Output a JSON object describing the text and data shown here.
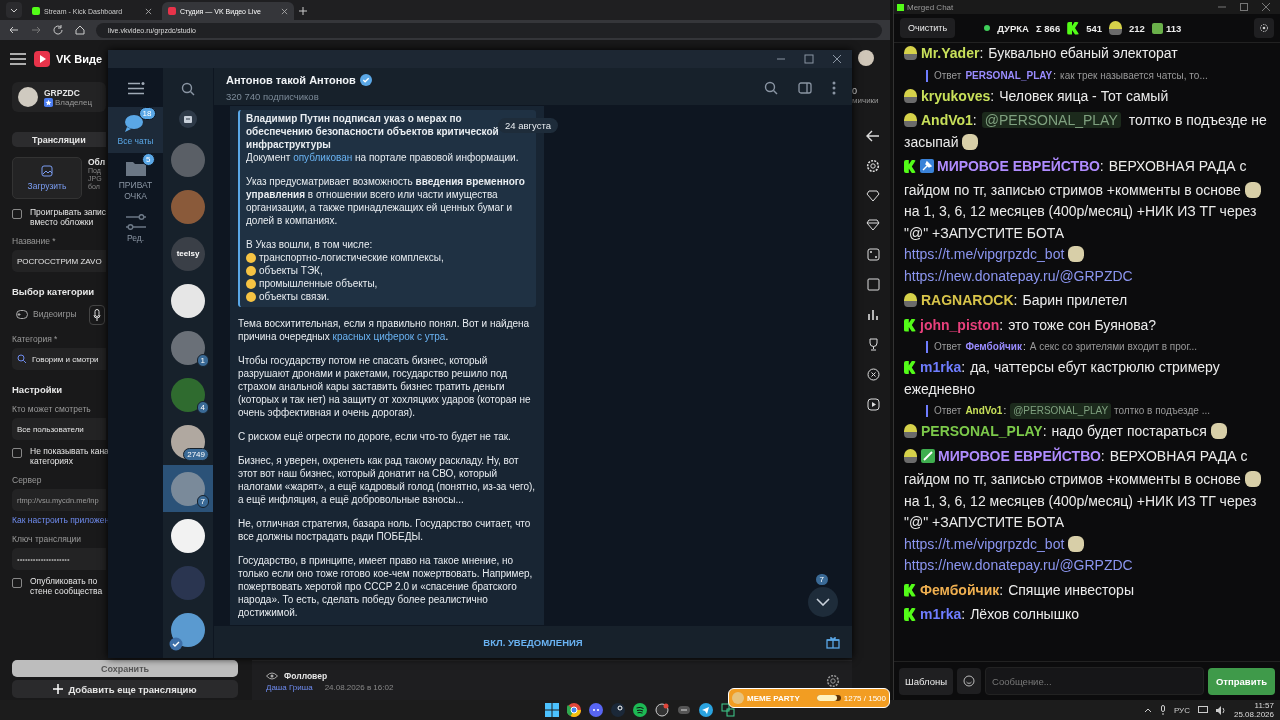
{
  "browser": {
    "tabs": [
      {
        "label": "Stream - Kick Dashboard",
        "selected": false
      },
      {
        "label": "Студия — VK Видео Live",
        "selected": true
      }
    ],
    "url": "live.vkvideo.ru/grpzdc/studio",
    "site_title": "VK Виде",
    "corner_count": "0",
    "corner_label": "мичики",
    "user": {
      "name": "GRPZDC",
      "role": "Владелец"
    },
    "section_tab": "Трансляции",
    "upload": {
      "button": "Загрузить",
      "title": "Обл",
      "hints": [
        "Под",
        "JPG",
        "бол"
      ]
    },
    "loop_check": {
      "lines": [
        "Проигрывать запис",
        "вместо обложки"
      ],
      "checked": false
    },
    "name_label": "Название *",
    "name_value": "РОСГОССТРИМ ZAVO",
    "category_heading": "Выбор категории",
    "category_chip": "Видеоигры",
    "category_label": "Категория *",
    "category_value": "Говорим и смотри",
    "settings_heading": "Настройки",
    "audience_label": "Кто может смотреть",
    "audience_value": "Все пользователи",
    "hide_check": {
      "lines": [
        "Не показывать кана",
        "категориях"
      ],
      "checked": false
    },
    "server_label": "Сервер",
    "server_value": "rtmp://vsu.mycdn.me/inp",
    "help_link": "Как настроить приложен",
    "key_label": "Ключ трансляции",
    "key_value": "••••••••••••••••••••",
    "publish_check": {
      "lines": [
        "Опубликовать по",
        "стене сообщества"
      ],
      "checked": false
    },
    "save_button": "Сохранить",
    "add_button": "Добавить еще трансляцию",
    "follower": {
      "label": "Фолловер",
      "name": "Даша Гриша",
      "date": "24.08.2026 в 16:02"
    }
  },
  "telegram": {
    "channel": "Антонов такой Антонов",
    "verified": true,
    "subscribers": "320 740 подписчиков",
    "folders": [
      {
        "label": "Все чаты",
        "badge": "18",
        "selected": true
      },
      {
        "label": "ПРИВАТ ОЧКА",
        "badge": "5",
        "selected": false
      },
      {
        "label": "Ред.",
        "selected": false
      }
    ],
    "chats": [
      {
        "selected": false
      },
      {
        "selected": false
      },
      {
        "selected": false,
        "label": "teelsy"
      },
      {
        "selected": false
      },
      {
        "selected": false,
        "badge": "1"
      },
      {
        "selected": false,
        "badge": "4"
      },
      {
        "selected": false,
        "badge": "2749"
      },
      {
        "selected": true,
        "badge": "7"
      },
      {
        "selected": false
      },
      {
        "selected": false
      },
      {
        "selected": false,
        "verified": true
      }
    ],
    "date_pill": "24 августа",
    "quote": {
      "title": "Владимир Путин подписал указ о мерах по обеспечению безопасности объектов критической инфраструктуры",
      "paragraphs": [
        [
          {
            "kind": "text",
            "text": "Документ "
          },
          {
            "kind": "link",
            "text": "опубликован"
          },
          {
            "kind": "text",
            "text": " на портале правовой информации."
          }
        ],
        [
          {
            "kind": "text",
            "text": "Указ предусматривает возможность **введения временного управления** в отношении всего или части имущества организации, а также принадлежащих ей ценных бумаг и долей в компаниях."
          }
        ]
      ],
      "list_intro": "В Указ вошли, в том числе:",
      "list": [
        "транспортно-логистические комплексы,",
        "объекты ТЭК,",
        "промышленные объекты,",
        "объекты связи."
      ]
    },
    "paragraphs": [
      [
        {
          "kind": "text",
          "text": "Тема восхитительная, если я правильно понял. Вот и найдена причина очередных "
        },
        {
          "kind": "link",
          "text": "красных циферок с утра"
        },
        {
          "kind": "text",
          "text": "."
        }
      ],
      [
        {
          "kind": "text",
          "text": "Чтобы государству потом не спасать бизнес, который разрушают дронами и ракетами, государство решило под страхом анальной кары заставить бизнес тратить деньги (которых и так нет) на защиту от хохляцких ударов (которая не очень эффективная и очень дорогая)."
        }
      ],
      [
        {
          "kind": "text",
          "text": "С риском ещё огрести по дороге, если что-то будет не так."
        }
      ],
      [
        {
          "kind": "text",
          "text": "Бизнес, я уверен, охренеть как рад такому раскладу. Ну, вот этот вот наш бизнес, который донатит на СВО, который налогами «жарят», а ещё кадровый голод (понятно, из-за чего), а ещё инфляция, а ещё добровольные взносы..."
        }
      ],
      [
        {
          "kind": "text",
          "text": "Не, отличная стратегия, базара ноль. Государство считает, что все должны пострадать ради ПОБЕДЫ."
        }
      ],
      [
        {
          "kind": "text",
          "text": "Государство, в принципе, имеет право на такое мнение, но только если оно тоже готово кое-чем пожертвовать. Например, пожертвовать херотой про СССР 2.0 и «спасение братского народа». То есть, сделать победу более реалистично достижимой."
        }
      ]
    ],
    "unread": "7",
    "footer": "ВКЛ. УВЕДОМЛЕНИЯ"
  },
  "chat": {
    "title": "Merged Chat",
    "clear_button": "Очистить",
    "channel": "ДУРКА",
    "total": "Σ 866",
    "counts": [
      {
        "kind": "kick",
        "value": "541"
      },
      {
        "kind": "figure",
        "value": "212"
      },
      {
        "kind": "green",
        "value": "113"
      }
    ],
    "messages": [
      {
        "kind": "message",
        "badges": [
          {
            "kind": "figure"
          }
        ],
        "user": "Mr.Yader",
        "separator": ":",
        "color": "#c8e05a",
        "segments": [
          {
            "kind": "text",
            "text": "Буквально ебаный электорат"
          }
        ]
      },
      {
        "kind": "reply",
        "prefix": "Ответ",
        "user": "PERSONAL_PLAY",
        "separator": ":",
        "color": "#9a8cff",
        "segments": [
          {
            "kind": "text",
            "text": "как трек называется чатсы, то..."
          }
        ]
      },
      {
        "kind": "message",
        "badges": [
          {
            "kind": "figure"
          }
        ],
        "user": "kryukoves",
        "separator": ":",
        "color": "#c8e05a",
        "segments": [
          {
            "kind": "text",
            "text": "Человек яица - Тот самый"
          }
        ]
      },
      {
        "kind": "message",
        "badges": [
          {
            "kind": "figure"
          }
        ],
        "user": "AndVo1",
        "separator": ":",
        "color": "#c8e05a",
        "segments": [
          {
            "kind": "mention",
            "text": "@PERSONAL_PLAY"
          },
          {
            "kind": "text",
            "text": " толтко в подъезде не засыпай"
          },
          {
            "kind": "emote"
          }
        ]
      },
      {
        "kind": "message",
        "badges": [
          {
            "kind": "kick"
          },
          {
            "kind": "tool"
          }
        ],
        "user": "МИРОВОЕ ЕВРЕЙСТВО",
        "separator": ":",
        "color": "#b08cff",
        "segments": [
          {
            "kind": "text",
            "text": "ВЕРХОВНАЯ РАДА с гайдом по тг, записью стримов +комменты в основе"
          },
          {
            "kind": "emote"
          },
          {
            "kind": "text",
            "text": "на 1, 3, 6, 12 месяцев (400р/месяц) +НИК ИЗ ТГ через \"@\" +ЗАПУСТИТЕ БОТА"
          },
          {
            "kind": "break"
          },
          {
            "kind": "link",
            "text": "https://t.me/vipgrpzdc_bot"
          },
          {
            "kind": "emote"
          },
          {
            "kind": "break"
          },
          {
            "kind": "link",
            "text": "https://new.donatepay.ru/@GRPZDC"
          }
        ]
      },
      {
        "kind": "message",
        "badges": [
          {
            "kind": "figure"
          }
        ],
        "user": "RAGNAROCK",
        "separator": ":",
        "color": "#d8c44a",
        "segments": [
          {
            "kind": "text",
            "text": "Барин прилетел"
          }
        ]
      },
      {
        "kind": "message",
        "badges": [
          {
            "kind": "kick"
          }
        ],
        "user": "john_piston",
        "separator": ":",
        "color": "#e8407c",
        "segments": [
          {
            "kind": "text",
            "text": "это тоже сон Буянова?"
          }
        ]
      },
      {
        "kind": "reply",
        "prefix": "Ответ",
        "user": "Фембойчик",
        "separator": ":",
        "color": "#9a8cff",
        "segments": [
          {
            "kind": "text",
            "text": "А секс со зрителями входит в прог..."
          }
        ]
      },
      {
        "kind": "message",
        "badges": [
          {
            "kind": "kick"
          }
        ],
        "user": "m1rka",
        "separator": ":",
        "color": "#6f7dff",
        "segments": [
          {
            "kind": "text",
            "text": "да, чаттерсы ебут кастрюлю стримеру ежедневно"
          }
        ]
      },
      {
        "kind": "reply",
        "prefix": "Ответ",
        "user": "AndVo1",
        "separator": ":",
        "color": "#c8e05a",
        "segments": [
          {
            "kind": "mention",
            "text": "@PERSONAL_PLAY"
          },
          {
            "kind": "text",
            "text": " толтко в подъезде ..."
          }
        ]
      },
      {
        "kind": "message",
        "badges": [
          {
            "kind": "figure"
          }
        ],
        "user": "PERSONAL_PLAY",
        "separator": ":",
        "color": "#7cc94a",
        "segments": [
          {
            "kind": "text",
            "text": "надо будет постараться"
          },
          {
            "kind": "emote"
          }
        ]
      },
      {
        "kind": "message",
        "badges": [
          {
            "kind": "figure"
          },
          {
            "kind": "check"
          }
        ],
        "user": "МИРОВОЕ ЕВРЕЙСТВО",
        "separator": ":",
        "color": "#b08cff",
        "segments": [
          {
            "kind": "text",
            "text": "ВЕРХОВНАЯ РАДА с гайдом по тг, записью стримов +комменты в основе"
          },
          {
            "kind": "emote"
          },
          {
            "kind": "text",
            "text": "на 1, 3, 6, 12 месяцев (400р/месяц) +НИК ИЗ ТГ через \"@\" +ЗАПУСТИТЕ БОТА"
          },
          {
            "kind": "break"
          },
          {
            "kind": "link",
            "text": "https://t.me/vipgrpzdc_bot"
          },
          {
            "kind": "emote"
          },
          {
            "kind": "break"
          },
          {
            "kind": "link",
            "text": "https://new.donatepay.ru/@GRPZDC"
          }
        ]
      },
      {
        "kind": "message",
        "badges": [
          {
            "kind": "kick"
          }
        ],
        "user": "Фембойчик",
        "separator": ":",
        "color": "#f0b050",
        "segments": [
          {
            "kind": "text",
            "text": "Спящие инвесторы"
          }
        ]
      },
      {
        "kind": "message",
        "badges": [
          {
            "kind": "kick"
          }
        ],
        "user": "m1rka",
        "separator": ":",
        "color": "#6f7dff",
        "segments": [
          {
            "kind": "text",
            "text": "Лёхов солнышко"
          }
        ]
      }
    ],
    "templates_button": "Шаблоны",
    "input_placeholder": "Сообщение...",
    "send_button": "Отправить"
  },
  "taskbar": {
    "widget": {
      "title": "MEME PARTY",
      "progress": "1275 / 1500",
      "level": 0.85
    },
    "language": "РУС",
    "time": "11:57",
    "date": "25.08.2026"
  }
}
